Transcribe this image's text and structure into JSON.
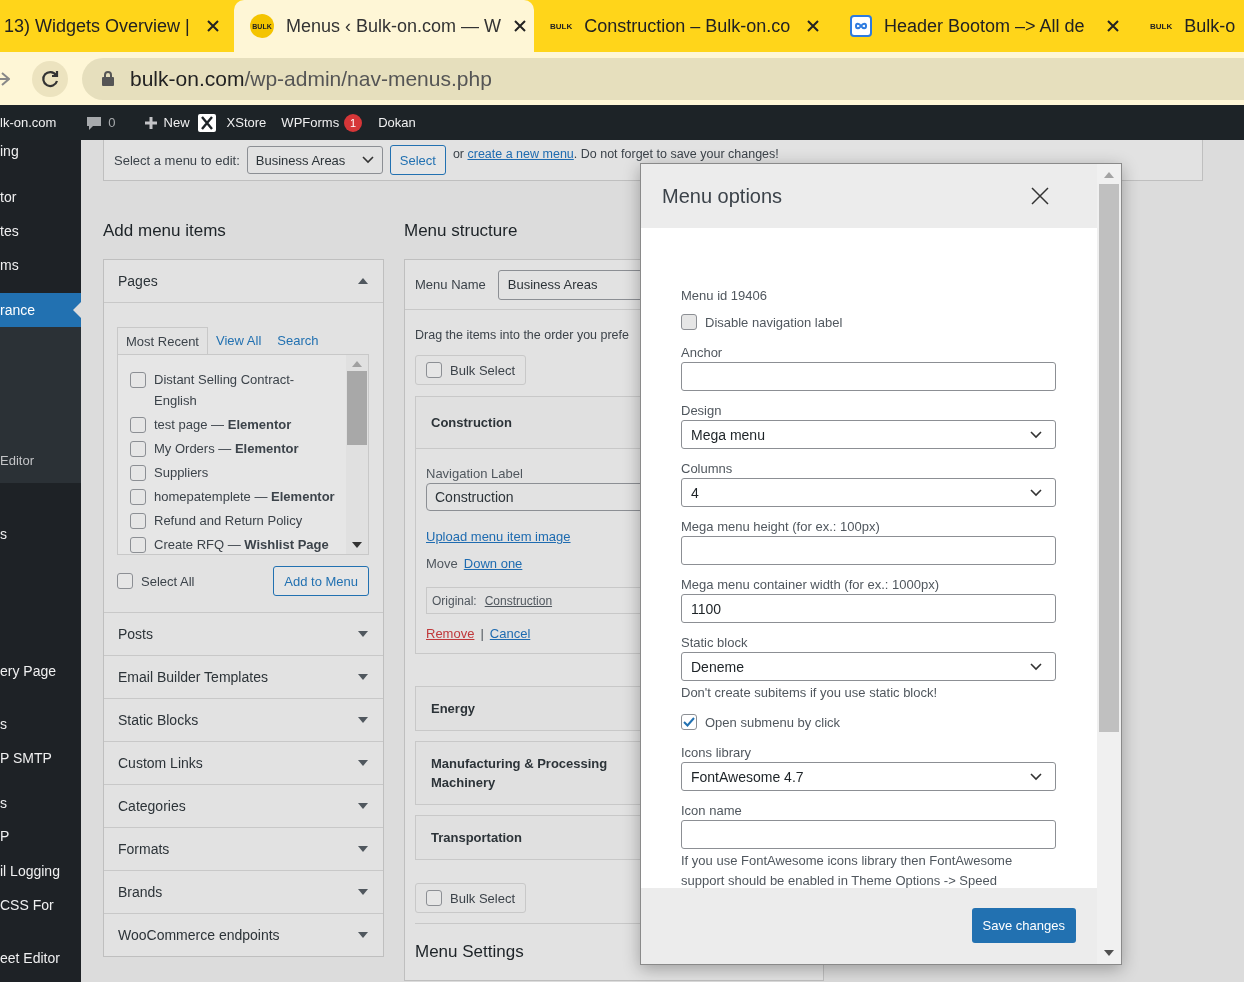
{
  "browser": {
    "tabs": [
      {
        "kind": "none",
        "title": "13) Widgets Overview | ",
        "closable": true,
        "selected": false
      },
      {
        "kind": "bulk-round",
        "favicon_text": "BULK",
        "title": "Menus ‹ Bulk-on.com — W",
        "closable": true,
        "selected": true
      },
      {
        "kind": "bulk",
        "favicon_text": "BULK",
        "title": "Construction – Bulk-on.co",
        "closable": true,
        "selected": false
      },
      {
        "kind": "link",
        "title": "Header Bootom –> All de",
        "closable": true,
        "selected": false
      },
      {
        "kind": "bulk",
        "favicon_text": "BULK",
        "title": "Bulk-o",
        "closable": false,
        "selected": false
      }
    ],
    "address": {
      "host": "bulk-on.com",
      "path": "/wp-admin/nav-menus.php"
    }
  },
  "admin_bar": {
    "site": "lk-on.com",
    "comments": "0",
    "new": "New",
    "xstore": "XStore",
    "wpforms": "WPForms",
    "wpforms_badge": "1",
    "dokan": "Dokan"
  },
  "sidebar": {
    "items": [
      {
        "label": "ing",
        "selected": false
      },
      {
        "label": "tor",
        "selected": false
      },
      {
        "label": "tes",
        "selected": false
      },
      {
        "label": "ms",
        "selected": false
      },
      {
        "label": "rance",
        "selected": true,
        "children": [
          {
            "label": "Editor"
          }
        ]
      },
      {
        "label": "s",
        "selected": false
      },
      {
        "label": "ery Page",
        "selected": false
      },
      {
        "label": "s",
        "selected": false
      },
      {
        "label": "P SMTP",
        "selected": false
      },
      {
        "label": "s",
        "selected": false
      },
      {
        "label": "P",
        "selected": false
      },
      {
        "label": "il Logging",
        "selected": false
      },
      {
        "label": "CSS For",
        "selected": false
      },
      {
        "label": "eet Editor",
        "selected": false
      }
    ]
  },
  "menu_select": {
    "label": "Select a menu to edit:",
    "value": "Business Areas",
    "button": "Select",
    "or": "or",
    "link": "create a new menu",
    "after": ". Do not forget to save your changes!"
  },
  "add_menu_items": {
    "title": "Add menu items",
    "sections": [
      {
        "title": "Pages",
        "expanded": true
      },
      {
        "title": "Posts",
        "expanded": false
      },
      {
        "title": "Email Builder Templates",
        "expanded": false
      },
      {
        "title": "Static Blocks",
        "expanded": false
      },
      {
        "title": "Custom Links",
        "expanded": false
      },
      {
        "title": "Categories",
        "expanded": false
      },
      {
        "title": "Formats",
        "expanded": false
      },
      {
        "title": "Brands",
        "expanded": false
      },
      {
        "title": "WooCommerce endpoints",
        "expanded": false
      }
    ],
    "pages": {
      "tabs": [
        {
          "label": "Most Recent",
          "selected": true
        },
        {
          "label": "View All",
          "selected": false
        },
        {
          "label": "Search",
          "selected": false
        }
      ],
      "items": [
        {
          "label": "Distant Selling Contract-English",
          "checked": false
        },
        {
          "label": "test page — **Elementor**",
          "checked": false
        },
        {
          "label": "My Orders — **Elementor**",
          "checked": false
        },
        {
          "label": "Suppliers",
          "checked": false
        },
        {
          "label": "homepatemplete — **Elementor**",
          "checked": false
        },
        {
          "label": "Refund and Return Policy",
          "checked": false
        },
        {
          "label": "Create RFQ — **Wishlist Page**",
          "checked": false
        }
      ],
      "select_all": {
        "label": "Select All",
        "checked": false
      },
      "add_button": "Add to Menu"
    }
  },
  "menu_structure": {
    "title": "Menu structure",
    "name_label": "Menu Name",
    "name_value": "Business Areas",
    "hint": "Drag the items into the order you prefe",
    "bulk_select": [
      {
        "label": "Bulk Select",
        "checked": false
      },
      {
        "label": "Bulk Select",
        "checked": false
      }
    ],
    "items": [
      {
        "title": "Construction",
        "expanded": true,
        "nav_label": "Navigation Label",
        "nav_value": "Construction",
        "upload": "Upload menu item image",
        "move": "Move",
        "move_link": "Down one",
        "original_label": "Original:",
        "original_link": "Construction",
        "remove": "Remove",
        "separator": "|",
        "cancel": "Cancel"
      },
      {
        "title": "Energy",
        "expanded": false
      },
      {
        "title": "Manufacturing & Processing Machinery",
        "expanded": false
      },
      {
        "title": "Transportation",
        "expanded": false
      }
    ],
    "settings_title": "Menu Settings"
  },
  "modal": {
    "title": "Menu options",
    "fields": [
      {
        "kind": "text",
        "text": "Menu id 19406"
      },
      {
        "kind": "checkbox",
        "label": "Disable navigation label",
        "checked": false
      },
      {
        "kind": "input",
        "label": "Anchor"
      },
      {
        "kind": "select",
        "label": "Design",
        "value": "Mega menu"
      },
      {
        "kind": "select",
        "label": "Columns",
        "value": "4"
      },
      {
        "kind": "input",
        "label": "Mega menu height (for ex.: 100px)"
      },
      {
        "kind": "input",
        "label": "Mega menu container width (for ex.: 1000px)",
        "value": "1100"
      },
      {
        "kind": "select",
        "label": "Static block",
        "value": "Deneme"
      },
      {
        "kind": "note",
        "text": "Don't create subitems if you use static block!"
      },
      {
        "kind": "checkbox",
        "label": "Open submenu by click",
        "checked": true
      },
      {
        "kind": "select",
        "label": "Icons library",
        "value": "FontAwesome 4.7"
      },
      {
        "kind": "input",
        "label": "Icon name"
      },
      {
        "kind": "note",
        "text": "If you use FontAwesome icons library then FontAwesome support should be enabled in Theme Options -> Speed"
      }
    ],
    "save_button": "Save changes"
  }
}
